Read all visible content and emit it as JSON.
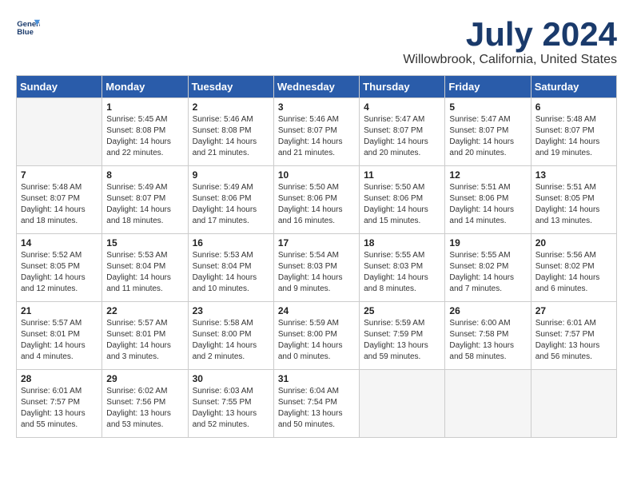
{
  "logo": {
    "line1": "General",
    "line2": "Blue"
  },
  "title": "July 2024",
  "location": "Willowbrook, California, United States",
  "days_of_week": [
    "Sunday",
    "Monday",
    "Tuesday",
    "Wednesday",
    "Thursday",
    "Friday",
    "Saturday"
  ],
  "weeks": [
    [
      {
        "day": "",
        "info": ""
      },
      {
        "day": "1",
        "info": "Sunrise: 5:45 AM\nSunset: 8:08 PM\nDaylight: 14 hours\nand 22 minutes."
      },
      {
        "day": "2",
        "info": "Sunrise: 5:46 AM\nSunset: 8:08 PM\nDaylight: 14 hours\nand 21 minutes."
      },
      {
        "day": "3",
        "info": "Sunrise: 5:46 AM\nSunset: 8:07 PM\nDaylight: 14 hours\nand 21 minutes."
      },
      {
        "day": "4",
        "info": "Sunrise: 5:47 AM\nSunset: 8:07 PM\nDaylight: 14 hours\nand 20 minutes."
      },
      {
        "day": "5",
        "info": "Sunrise: 5:47 AM\nSunset: 8:07 PM\nDaylight: 14 hours\nand 20 minutes."
      },
      {
        "day": "6",
        "info": "Sunrise: 5:48 AM\nSunset: 8:07 PM\nDaylight: 14 hours\nand 19 minutes."
      }
    ],
    [
      {
        "day": "7",
        "info": "Sunrise: 5:48 AM\nSunset: 8:07 PM\nDaylight: 14 hours\nand 18 minutes."
      },
      {
        "day": "8",
        "info": "Sunrise: 5:49 AM\nSunset: 8:07 PM\nDaylight: 14 hours\nand 18 minutes."
      },
      {
        "day": "9",
        "info": "Sunrise: 5:49 AM\nSunset: 8:06 PM\nDaylight: 14 hours\nand 17 minutes."
      },
      {
        "day": "10",
        "info": "Sunrise: 5:50 AM\nSunset: 8:06 PM\nDaylight: 14 hours\nand 16 minutes."
      },
      {
        "day": "11",
        "info": "Sunrise: 5:50 AM\nSunset: 8:06 PM\nDaylight: 14 hours\nand 15 minutes."
      },
      {
        "day": "12",
        "info": "Sunrise: 5:51 AM\nSunset: 8:06 PM\nDaylight: 14 hours\nand 14 minutes."
      },
      {
        "day": "13",
        "info": "Sunrise: 5:51 AM\nSunset: 8:05 PM\nDaylight: 14 hours\nand 13 minutes."
      }
    ],
    [
      {
        "day": "14",
        "info": "Sunrise: 5:52 AM\nSunset: 8:05 PM\nDaylight: 14 hours\nand 12 minutes."
      },
      {
        "day": "15",
        "info": "Sunrise: 5:53 AM\nSunset: 8:04 PM\nDaylight: 14 hours\nand 11 minutes."
      },
      {
        "day": "16",
        "info": "Sunrise: 5:53 AM\nSunset: 8:04 PM\nDaylight: 14 hours\nand 10 minutes."
      },
      {
        "day": "17",
        "info": "Sunrise: 5:54 AM\nSunset: 8:03 PM\nDaylight: 14 hours\nand 9 minutes."
      },
      {
        "day": "18",
        "info": "Sunrise: 5:55 AM\nSunset: 8:03 PM\nDaylight: 14 hours\nand 8 minutes."
      },
      {
        "day": "19",
        "info": "Sunrise: 5:55 AM\nSunset: 8:02 PM\nDaylight: 14 hours\nand 7 minutes."
      },
      {
        "day": "20",
        "info": "Sunrise: 5:56 AM\nSunset: 8:02 PM\nDaylight: 14 hours\nand 6 minutes."
      }
    ],
    [
      {
        "day": "21",
        "info": "Sunrise: 5:57 AM\nSunset: 8:01 PM\nDaylight: 14 hours\nand 4 minutes."
      },
      {
        "day": "22",
        "info": "Sunrise: 5:57 AM\nSunset: 8:01 PM\nDaylight: 14 hours\nand 3 minutes."
      },
      {
        "day": "23",
        "info": "Sunrise: 5:58 AM\nSunset: 8:00 PM\nDaylight: 14 hours\nand 2 minutes."
      },
      {
        "day": "24",
        "info": "Sunrise: 5:59 AM\nSunset: 8:00 PM\nDaylight: 14 hours\nand 0 minutes."
      },
      {
        "day": "25",
        "info": "Sunrise: 5:59 AM\nSunset: 7:59 PM\nDaylight: 13 hours\nand 59 minutes."
      },
      {
        "day": "26",
        "info": "Sunrise: 6:00 AM\nSunset: 7:58 PM\nDaylight: 13 hours\nand 58 minutes."
      },
      {
        "day": "27",
        "info": "Sunrise: 6:01 AM\nSunset: 7:57 PM\nDaylight: 13 hours\nand 56 minutes."
      }
    ],
    [
      {
        "day": "28",
        "info": "Sunrise: 6:01 AM\nSunset: 7:57 PM\nDaylight: 13 hours\nand 55 minutes."
      },
      {
        "day": "29",
        "info": "Sunrise: 6:02 AM\nSunset: 7:56 PM\nDaylight: 13 hours\nand 53 minutes."
      },
      {
        "day": "30",
        "info": "Sunrise: 6:03 AM\nSunset: 7:55 PM\nDaylight: 13 hours\nand 52 minutes."
      },
      {
        "day": "31",
        "info": "Sunrise: 6:04 AM\nSunset: 7:54 PM\nDaylight: 13 hours\nand 50 minutes."
      },
      {
        "day": "",
        "info": ""
      },
      {
        "day": "",
        "info": ""
      },
      {
        "day": "",
        "info": ""
      }
    ]
  ]
}
